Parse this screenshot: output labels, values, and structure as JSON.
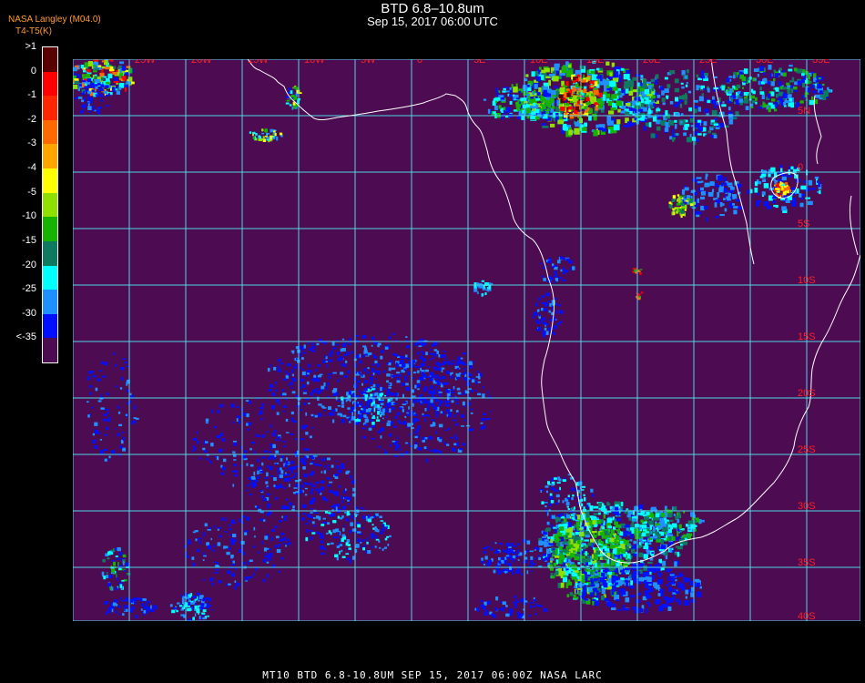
{
  "header": {
    "title": "BTD 6.8–10.8um",
    "subtitle": "Sep 15, 2017 06:00 UTC",
    "credit": "NASA Langley (M04.0)",
    "units": "T4-T5(K)"
  },
  "legend": {
    "labels": [
      ">1",
      "0",
      "-1",
      "-2",
      "-3",
      "-4",
      "-5",
      "-10",
      "-15",
      "-20",
      "-25",
      "-30",
      "<-35"
    ],
    "colors": [
      "#5a0000",
      "#ff0000",
      "#ff2600",
      "#ff6a00",
      "#ffa500",
      "#ffff00",
      "#8fe000",
      "#16b400",
      "#0f7a60",
      "#00ffff",
      "#1e90ff",
      "#0010ff",
      "#4d0b52"
    ]
  },
  "map": {
    "background_color": "#4d0b52",
    "grid_color": "#4fd7e6",
    "coast_color": "#ffffff",
    "grid_label_color": "#ff2020",
    "lon_labels": [
      "25W",
      "20W",
      "15W",
      "10W",
      "5W",
      "0",
      "5E",
      "10E",
      "15E",
      "20E",
      "25E",
      "30E",
      "35E"
    ],
    "lat_labels": [
      "5N",
      "0",
      "5S",
      "10S",
      "15S",
      "20S",
      "25S",
      "30S",
      "35S",
      "40S"
    ]
  },
  "footer": {
    "caption": "MT10   BTD 6.8-10.8UM   SEP 15, 2017 06:00Z   NASA LARC"
  }
}
